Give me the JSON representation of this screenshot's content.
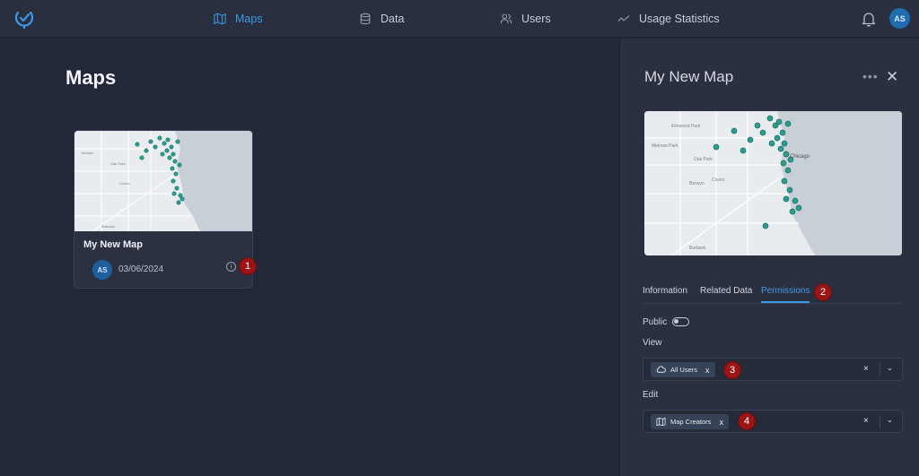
{
  "nav": {
    "items": [
      {
        "label": "Maps",
        "icon": "map-icon",
        "active": true
      },
      {
        "label": "Data",
        "icon": "database-icon",
        "active": false
      },
      {
        "label": "Users",
        "icon": "users-icon",
        "active": false
      },
      {
        "label": "Usage Statistics",
        "icon": "trend-icon",
        "active": false
      }
    ],
    "avatar": "AS",
    "accent": "#3b9ae8"
  },
  "main": {
    "title": "Maps",
    "card": {
      "name": "My New Map",
      "avatar": "AS",
      "date": "03/06/2024",
      "info_icon": "i"
    }
  },
  "markers": [
    "1",
    "2",
    "3",
    "4"
  ],
  "panel": {
    "title": "My New Map",
    "more": "•••",
    "close": "✕",
    "tabs": [
      "Information",
      "Related Data",
      "Permissions"
    ],
    "active_tab": "Permissions",
    "public_label": "Public",
    "view_label": "View",
    "edit_label": "Edit",
    "view_chip": "All Users",
    "edit_chip": "Map Creators",
    "chip_remove": "x",
    "clear": "×",
    "dropdown": "⌄"
  },
  "map_labels": {
    "card": [
      "Berwyn",
      "Oak Park",
      "Cicero",
      "Burbank"
    ],
    "panel": [
      "Elmwood Park",
      "Melrose Park",
      "Oak Park",
      "Berwyn",
      "Cicero",
      "Burbank",
      "Chicago"
    ]
  }
}
